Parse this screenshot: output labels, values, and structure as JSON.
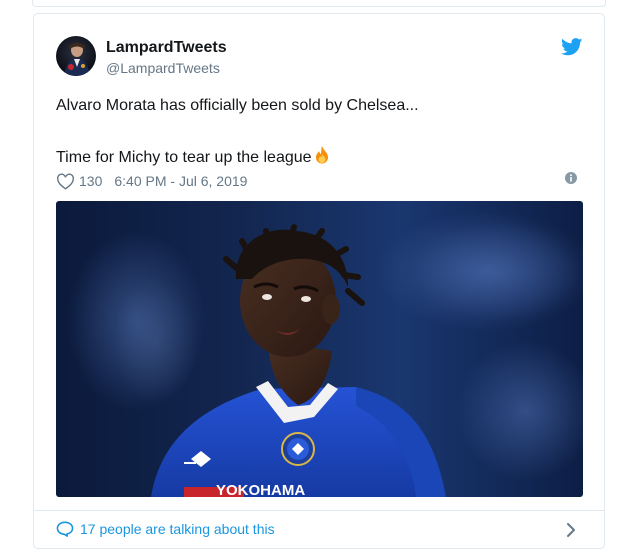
{
  "tweet": {
    "display_name": "LampardTweets",
    "handle": "@LampardTweets",
    "text_line1": "Alvaro Morata has officially been sold by Chelsea...",
    "text_line2": "Time for Michy to tear up the league",
    "likes": "130",
    "timestamp": "6:40 PM - Jul 6, 2019",
    "image_sponsor_text": "YOKOHAMA"
  },
  "footer": {
    "conversation_label": "17 people are talking about this"
  },
  "colors": {
    "twitter_blue": "#1da1f2",
    "link_blue": "#1b95e0",
    "muted": "#657786",
    "border": "#e1e8ed",
    "chelsea_blue": "#1f44b8"
  },
  "icons": {
    "bird": "twitter-bird-icon",
    "like": "heart-icon",
    "info": "info-icon",
    "conversation": "speech-bubble-icon",
    "next": "chevron-right-icon",
    "emoji": "fire-emoji"
  }
}
